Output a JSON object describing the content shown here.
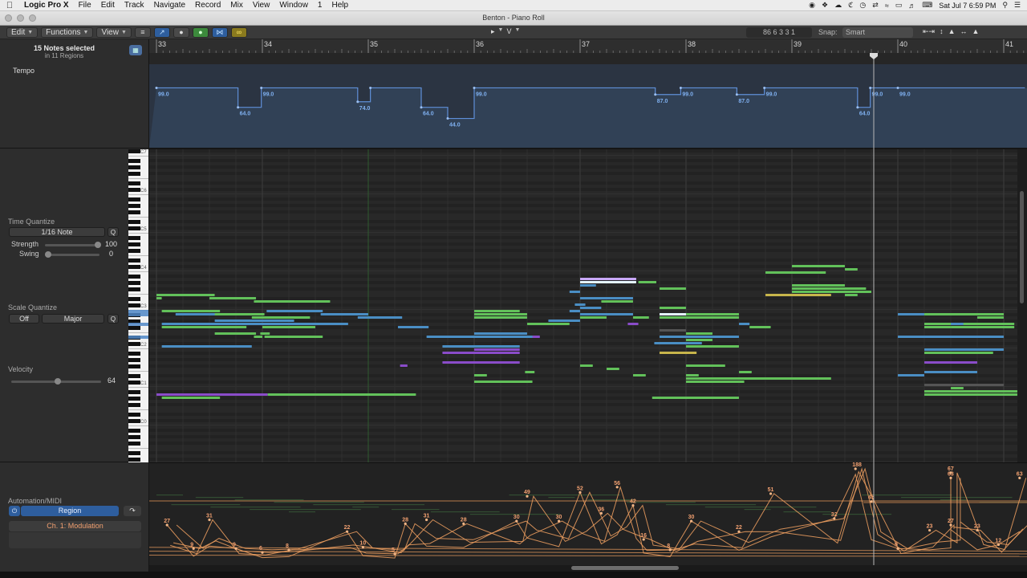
{
  "menubar": {
    "app": "Logic Pro X",
    "items": [
      "File",
      "Edit",
      "Track",
      "Navigate",
      "Record",
      "Mix",
      "View",
      "Window",
      "1",
      "Help"
    ],
    "clock": "Sat Jul 7  6:59 PM"
  },
  "window": {
    "title": "Benton - Piano Roll"
  },
  "toolbar": {
    "edit": "Edit",
    "functions": "Functions",
    "view": "View",
    "tool_pointer": "▸",
    "tool_secondary": "V",
    "position": "86  6 3 3 1",
    "snap_label": "Snap:",
    "snap_value": "Smart"
  },
  "inspector": {
    "selection": "15 Notes selected",
    "selection_sub": "in 11 Regions",
    "tempo_label": "Tempo",
    "time_quantize": "Time Quantize",
    "quantize_value": "1/16 Note",
    "q_label": "Q",
    "strength_label": "Strength",
    "strength_value": "100",
    "swing_label": "Swing",
    "swing_value": "0",
    "scale_quantize": "Scale Quantize",
    "scale_off": "Off",
    "scale_major": "Major",
    "velocity_label": "Velocity",
    "velocity_value": "64",
    "automation_label": "Automation/MIDI",
    "region_button": "Region",
    "parameter": "Ch. 1: Modulation"
  },
  "ruler": {
    "bars": [
      "33",
      "34",
      "35",
      "36",
      "37",
      "38",
      "39",
      "40",
      "41"
    ]
  },
  "tempo": {
    "axis": [
      "130",
      "110",
      "90",
      "70",
      "50",
      "30",
      "0"
    ],
    "segments": [
      {
        "t1": 0.0,
        "t2": 0.77,
        "v": 99.0,
        "label": "99.0"
      },
      {
        "t1": 0.77,
        "t2": 0.99,
        "v": 64.0,
        "label": "64.0"
      },
      {
        "t1": 0.99,
        "t2": 1.9,
        "v": 99.0,
        "label": "99.0"
      },
      {
        "t1": 1.9,
        "t2": 2.02,
        "v": 74.0,
        "label": "74.0"
      },
      {
        "t1": 2.02,
        "t2": 2.5,
        "v": 99.0,
        "label": ""
      },
      {
        "t1": 2.5,
        "t2": 2.75,
        "v": 64.0,
        "label": "64.0"
      },
      {
        "t1": 2.75,
        "t2": 3.0,
        "v": 44.0,
        "label": "44.0"
      },
      {
        "t1": 3.0,
        "t2": 4.71,
        "v": 99.0,
        "label": "99.0"
      },
      {
        "t1": 4.71,
        "t2": 4.95,
        "v": 87.0,
        "label": "87.0"
      },
      {
        "t1": 4.95,
        "t2": 5.48,
        "v": 99.0,
        "label": "99.0"
      },
      {
        "t1": 5.48,
        "t2": 5.74,
        "v": 87.0,
        "label": "87.0"
      },
      {
        "t1": 5.74,
        "t2": 6.62,
        "v": 99.0,
        "label": "99.0"
      },
      {
        "t1": 6.62,
        "t2": 6.74,
        "v": 64.0,
        "label": "64.0"
      },
      {
        "t1": 6.74,
        "t2": 7.0,
        "v": 99.0,
        "label": "99.0"
      },
      {
        "t1": 7.0,
        "t2": 8.2,
        "v": 99.0,
        "label": "99.0"
      }
    ]
  },
  "keyboard": {
    "octaves": [
      "C7",
      "C6",
      "C5",
      "C4",
      "C3",
      "C2",
      "C1",
      "C0"
    ]
  },
  "notes": [
    {
      "s": 0.0,
      "e": 0.55,
      "p": 52,
      "c": "green"
    },
    {
      "s": 0.5,
      "e": 0.94,
      "p": 51,
      "c": "green"
    },
    {
      "s": 0.0,
      "e": 0.05,
      "p": 51,
      "c": "green"
    },
    {
      "s": 0.92,
      "e": 1.03,
      "p": 50,
      "c": "green"
    },
    {
      "s": 1.0,
      "e": 1.64,
      "p": 50,
      "c": "green"
    },
    {
      "s": 0.05,
      "e": 0.6,
      "p": 47,
      "c": "green"
    },
    {
      "s": 1.04,
      "e": 1.57,
      "p": 47,
      "c": "blue"
    },
    {
      "s": 0.18,
      "e": 0.94,
      "p": 46,
      "c": "blue"
    },
    {
      "s": 0.55,
      "e": 1.02,
      "p": 46,
      "c": "green"
    },
    {
      "s": 0.9,
      "e": 1.45,
      "p": 45,
      "c": "green"
    },
    {
      "s": 1.55,
      "e": 2.0,
      "p": 46,
      "c": "blue"
    },
    {
      "s": 1.9,
      "e": 2.32,
      "p": 45,
      "c": "blue"
    },
    {
      "s": 0.55,
      "e": 1.3,
      "p": 44,
      "c": "blue"
    },
    {
      "s": 0.05,
      "e": 1.81,
      "p": 43,
      "c": "blue"
    },
    {
      "s": 0.05,
      "e": 0.85,
      "p": 42,
      "c": "green"
    },
    {
      "s": 1.0,
      "e": 1.5,
      "p": 42,
      "c": "green"
    },
    {
      "s": 2.28,
      "e": 2.57,
      "p": 42,
      "c": "blue"
    },
    {
      "s": 0.55,
      "e": 0.94,
      "p": 40,
      "c": "green"
    },
    {
      "s": 0.98,
      "e": 1.07,
      "p": 40,
      "c": "green"
    },
    {
      "s": 0.92,
      "e": 1.0,
      "p": 39,
      "c": "green"
    },
    {
      "s": 1.02,
      "e": 1.57,
      "p": 39,
      "c": "green"
    },
    {
      "s": 0.05,
      "e": 0.9,
      "p": 36,
      "c": "blue"
    },
    {
      "s": 2.55,
      "e": 3.6,
      "p": 39,
      "c": "blue"
    },
    {
      "s": 2.7,
      "e": 3.43,
      "p": 36,
      "c": "blue"
    },
    {
      "s": 3.0,
      "e": 3.43,
      "p": 35,
      "c": "purple"
    },
    {
      "s": 2.7,
      "e": 3.43,
      "p": 34,
      "c": "purple"
    },
    {
      "s": 2.7,
      "e": 3.43,
      "p": 31,
      "c": "purple"
    },
    {
      "s": 3.0,
      "e": 3.43,
      "p": 47,
      "c": "green"
    },
    {
      "s": 3.0,
      "e": 3.5,
      "p": 46,
      "c": "green"
    },
    {
      "s": 3.0,
      "e": 3.5,
      "p": 45,
      "c": "green"
    },
    {
      "s": 3.5,
      "e": 3.9,
      "p": 43,
      "c": "green"
    },
    {
      "s": 3.7,
      "e": 4.0,
      "p": 44,
      "c": "blue"
    },
    {
      "s": 3.0,
      "e": 3.5,
      "p": 40,
      "c": "blue"
    },
    {
      "s": 3.0,
      "e": 3.55,
      "p": 39,
      "c": "blue"
    },
    {
      "s": 3.55,
      "e": 3.62,
      "p": 39,
      "c": "purple"
    },
    {
      "s": 3.0,
      "e": 3.12,
      "p": 27,
      "c": "green"
    },
    {
      "s": 3.0,
      "e": 3.55,
      "p": 25,
      "c": "green"
    },
    {
      "s": 3.48,
      "e": 3.57,
      "p": 28,
      "c": "green"
    },
    {
      "s": 4.0,
      "e": 4.53,
      "p": 57,
      "c": "lavender"
    },
    {
      "s": 4.0,
      "e": 4.53,
      "p": 56,
      "c": "white"
    },
    {
      "s": 4.0,
      "e": 4.15,
      "p": 55,
      "c": "blue"
    },
    {
      "s": 4.55,
      "e": 4.72,
      "p": 56,
      "c": "green"
    },
    {
      "s": 3.9,
      "e": 4.0,
      "p": 53,
      "c": "blue"
    },
    {
      "s": 4.0,
      "e": 4.5,
      "p": 51,
      "c": "blue"
    },
    {
      "s": 4.2,
      "e": 4.5,
      "p": 50,
      "c": "green"
    },
    {
      "s": 3.95,
      "e": 4.05,
      "p": 49,
      "c": "blue"
    },
    {
      "s": 4.0,
      "e": 4.2,
      "p": 48,
      "c": "blue"
    },
    {
      "s": 3.9,
      "e": 4.0,
      "p": 47,
      "c": "blue"
    },
    {
      "s": 4.0,
      "e": 4.5,
      "p": 46,
      "c": "blue"
    },
    {
      "s": 4.0,
      "e": 4.25,
      "p": 45,
      "c": "green"
    },
    {
      "s": 4.5,
      "e": 4.65,
      "p": 45,
      "c": "green"
    },
    {
      "s": 4.45,
      "e": 4.55,
      "p": 43,
      "c": "purple"
    },
    {
      "s": 4.0,
      "e": 4.12,
      "p": 30,
      "c": "green"
    },
    {
      "s": 4.25,
      "e": 4.37,
      "p": 29,
      "c": "green"
    },
    {
      "s": 4.5,
      "e": 4.62,
      "p": 27,
      "c": "green"
    },
    {
      "s": 4.75,
      "e": 5.0,
      "p": 54,
      "c": "green"
    },
    {
      "s": 4.75,
      "e": 5.0,
      "p": 48,
      "c": "green"
    },
    {
      "s": 4.75,
      "e": 5.0,
      "p": 46,
      "c": "white"
    },
    {
      "s": 5.0,
      "e": 5.5,
      "p": 46,
      "c": "green"
    },
    {
      "s": 4.75,
      "e": 5.0,
      "p": 45,
      "c": "green"
    },
    {
      "s": 5.0,
      "e": 5.5,
      "p": 45,
      "c": "green"
    },
    {
      "s": 5.5,
      "e": 5.6,
      "p": 43,
      "c": "blue"
    },
    {
      "s": 5.6,
      "e": 5.8,
      "p": 42,
      "c": "green"
    },
    {
      "s": 4.75,
      "e": 5.0,
      "p": 41,
      "c": "gray"
    },
    {
      "s": 5.0,
      "e": 5.25,
      "p": 40,
      "c": "green"
    },
    {
      "s": 4.75,
      "e": 5.5,
      "p": 39,
      "c": "blue"
    },
    {
      "s": 5.0,
      "e": 5.25,
      "p": 38,
      "c": "green"
    },
    {
      "s": 4.7,
      "e": 5.15,
      "p": 37,
      "c": "blue"
    },
    {
      "s": 5.0,
      "e": 5.5,
      "p": 36,
      "c": "green"
    },
    {
      "s": 4.75,
      "e": 5.1,
      "p": 34,
      "c": "yellow"
    },
    {
      "s": 5.0,
      "e": 5.37,
      "p": 30,
      "c": "green"
    },
    {
      "s": 5.0,
      "e": 5.12,
      "p": 27,
      "c": "green"
    },
    {
      "s": 5.5,
      "e": 5.62,
      "p": 28,
      "c": "green"
    },
    {
      "s": 5.0,
      "e": 6.37,
      "p": 26,
      "c": "green"
    },
    {
      "s": 5.0,
      "e": 5.55,
      "p": 25,
      "c": "green"
    },
    {
      "s": 4.68,
      "e": 5.5,
      "p": 20,
      "c": "green"
    },
    {
      "s": 6.0,
      "e": 6.5,
      "p": 61,
      "c": "green"
    },
    {
      "s": 6.5,
      "e": 6.62,
      "p": 60,
      "c": "green"
    },
    {
      "s": 5.75,
      "e": 6.32,
      "p": 59,
      "c": "green"
    },
    {
      "s": 6.0,
      "e": 6.5,
      "p": 55,
      "c": "green"
    },
    {
      "s": 6.0,
      "e": 6.7,
      "p": 54,
      "c": "green"
    },
    {
      "s": 6.0,
      "e": 6.75,
      "p": 53,
      "c": "green"
    },
    {
      "s": 5.75,
      "e": 6.37,
      "p": 52,
      "c": "yellow"
    },
    {
      "s": 6.5,
      "e": 6.62,
      "p": 52,
      "c": "green"
    },
    {
      "s": 7.0,
      "e": 7.25,
      "p": 46,
      "c": "blue"
    },
    {
      "s": 7.25,
      "e": 8.0,
      "p": 46,
      "c": "green"
    },
    {
      "s": 7.75,
      "e": 8.0,
      "p": 45,
      "c": "green"
    },
    {
      "s": 7.25,
      "e": 7.7,
      "p": 43,
      "c": "green"
    },
    {
      "s": 7.5,
      "e": 7.62,
      "p": 43,
      "c": "blue"
    },
    {
      "s": 7.62,
      "e": 8.1,
      "p": 43,
      "c": "green"
    },
    {
      "s": 7.25,
      "e": 7.5,
      "p": 42,
      "c": "green"
    },
    {
      "s": 7.5,
      "e": 8.1,
      "p": 42,
      "c": "green"
    },
    {
      "s": 7.0,
      "e": 8.0,
      "p": 39,
      "c": "blue"
    },
    {
      "s": 7.25,
      "e": 8.0,
      "p": 35,
      "c": "blue"
    },
    {
      "s": 7.25,
      "e": 7.9,
      "p": 34,
      "c": "green"
    },
    {
      "s": 7.25,
      "e": 7.75,
      "p": 31,
      "c": "purple"
    },
    {
      "s": 7.25,
      "e": 7.75,
      "p": 28,
      "c": "blue"
    },
    {
      "s": 7.0,
      "e": 7.25,
      "p": 27,
      "c": "blue"
    },
    {
      "s": 7.25,
      "e": 8.0,
      "p": 24,
      "c": "gray"
    },
    {
      "s": 7.5,
      "e": 7.62,
      "p": 23,
      "c": "green"
    },
    {
      "s": 7.25,
      "e": 8.2,
      "p": 22,
      "c": "green"
    },
    {
      "s": 7.25,
      "e": 8.2,
      "p": 21,
      "c": "green"
    },
    {
      "s": 2.3,
      "e": 2.37,
      "p": 30,
      "c": "purple"
    },
    {
      "s": 0.0,
      "e": 1.05,
      "p": 21,
      "c": "purple"
    },
    {
      "s": 1.05,
      "e": 2.45,
      "p": 21,
      "c": "green"
    },
    {
      "s": 0.05,
      "e": 0.6,
      "p": 20,
      "c": "green"
    }
  ],
  "automation": {
    "labels": [
      {
        "t": 0.1,
        "v": 27,
        "l": "27"
      },
      {
        "t": 0.5,
        "v": 31,
        "l": "31"
      },
      {
        "t": 0.35,
        "v": 9,
        "l": "9"
      },
      {
        "t": 0.75,
        "v": 9,
        "l": "9"
      },
      {
        "t": 1.0,
        "v": 6,
        "l": "6"
      },
      {
        "t": 1.25,
        "v": 8,
        "l": "8"
      },
      {
        "t": 1.8,
        "v": 22,
        "l": "22"
      },
      {
        "t": 1.95,
        "v": 10,
        "l": "10"
      },
      {
        "t": 2.35,
        "v": 28,
        "l": "28"
      },
      {
        "t": 2.55,
        "v": 31,
        "l": "31"
      },
      {
        "t": 2.25,
        "v": 5,
        "l": "5"
      },
      {
        "t": 2.9,
        "v": 28,
        "l": "28"
      },
      {
        "t": 3.5,
        "v": 49,
        "l": "49"
      },
      {
        "t": 3.4,
        "v": 30,
        "l": "30"
      },
      {
        "t": 3.8,
        "v": 30,
        "l": "30"
      },
      {
        "t": 4.0,
        "v": 52,
        "l": "52"
      },
      {
        "t": 4.35,
        "v": 56,
        "l": "56"
      },
      {
        "t": 4.5,
        "v": 42,
        "l": "42"
      },
      {
        "t": 4.2,
        "v": 36,
        "l": "36"
      },
      {
        "t": 4.6,
        "v": 16,
        "l": "16"
      },
      {
        "t": 4.85,
        "v": 8,
        "l": "8"
      },
      {
        "t": 5.05,
        "v": 30,
        "l": "30"
      },
      {
        "t": 5.5,
        "v": 22,
        "l": "22"
      },
      {
        "t": 5.8,
        "v": 51,
        "l": "51"
      },
      {
        "t": 6.4,
        "v": 32,
        "l": "32"
      },
      {
        "t": 6.75,
        "v": 45,
        "l": "45"
      },
      {
        "t": 6.6,
        "v": 188,
        "l": "188"
      },
      {
        "t": 7.0,
        "v": 9,
        "l": "9"
      },
      {
        "t": 7.3,
        "v": 23,
        "l": "23"
      },
      {
        "t": 7.5,
        "v": 27,
        "l": "27"
      },
      {
        "t": 7.75,
        "v": 23,
        "l": "23"
      },
      {
        "t": 7.5,
        "v": 63,
        "l": "63"
      },
      {
        "t": 7.5,
        "v": 67,
        "l": "67"
      },
      {
        "t": 8.15,
        "v": 63,
        "l": "63"
      },
      {
        "t": 7.95,
        "v": 12,
        "l": "12"
      }
    ]
  },
  "colors": {
    "note_green": "#62c15a",
    "note_blue": "#4a8ec4",
    "note_purple": "#8a4cc9",
    "note_yellow": "#c7b54b",
    "note_white": "#e4f4ff",
    "note_lavender": "#c9a8ff",
    "tempo_line": "#5f8fd8",
    "automation": "#f0a060"
  }
}
